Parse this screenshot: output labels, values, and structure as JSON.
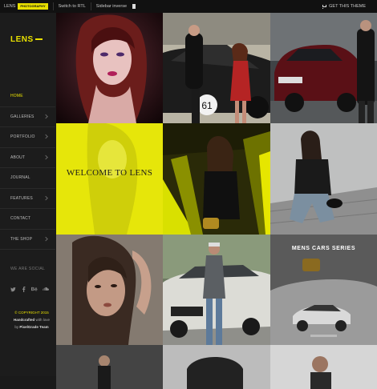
{
  "topbar": {
    "brand": "LENS",
    "badge": "PHOTOGRAPHY",
    "items": [
      "Switch to RTL",
      "Sidebar inverse"
    ],
    "cta": "GET THIS THEME"
  },
  "sidebar": {
    "logo": "LENS",
    "menu": [
      {
        "label": "HOME",
        "active": true,
        "has_children": false
      },
      {
        "label": "GALLERIES",
        "active": false,
        "has_children": true
      },
      {
        "label": "PORTFOLIO",
        "active": false,
        "has_children": true
      },
      {
        "label": "ABOUT",
        "active": false,
        "has_children": true
      },
      {
        "label": "JOURNAL",
        "active": false,
        "has_children": false
      },
      {
        "label": "FEATURES",
        "active": false,
        "has_children": true
      },
      {
        "label": "CONTACT",
        "active": false,
        "has_children": false
      },
      {
        "label": "THE SHOP",
        "active": false,
        "has_children": true
      }
    ],
    "social_title": "WE ARE SOCIAL",
    "social_icons": [
      "twitter-icon",
      "facebook-icon",
      "behance-icon",
      "soundcloud-icon"
    ],
    "footer": {
      "copyright": "© COPYRIGHT 2015",
      "line2_prefix": "Handcrafted",
      "line2_suffix": " with love",
      "line3_prefix": "by ",
      "line3_strong": "PixelGrade Team"
    }
  },
  "grid": {
    "tiles": [
      {
        "id": "portrait-red-hair",
        "caption": ""
      },
      {
        "id": "couple-vintage-racecar",
        "caption": ""
      },
      {
        "id": "man-red-suv",
        "caption": ""
      },
      {
        "id": "welcome",
        "caption": "WELCOME TO LENS"
      },
      {
        "id": "woman-tunnel-yellow",
        "caption": ""
      },
      {
        "id": "woman-leather-jacket",
        "caption": ""
      },
      {
        "id": "woman-closeup",
        "caption": ""
      },
      {
        "id": "man-white-bmw",
        "caption": ""
      },
      {
        "id": "mens-cars-series",
        "caption": "MENS CARS SERIES"
      },
      {
        "id": "partial-1",
        "caption": ""
      },
      {
        "id": "partial-2",
        "caption": ""
      },
      {
        "id": "partial-3",
        "caption": ""
      }
    ]
  },
  "colors": {
    "accent": "#e8e000",
    "background": "#1a1a1a",
    "sidebar": "#1c1c1c"
  }
}
